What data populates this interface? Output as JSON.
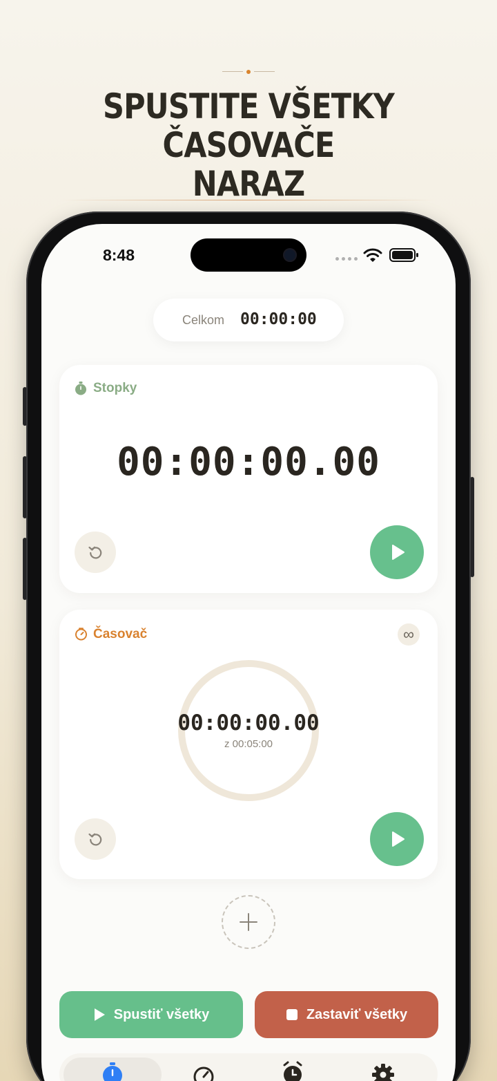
{
  "headline": {
    "line1": "SPUSTITE VŠETKY ČASOVAČE",
    "line2": "NARAZ"
  },
  "status_bar": {
    "time": "8:48"
  },
  "total": {
    "label": "Celkom",
    "value": "00:00:00"
  },
  "stopwatch_card": {
    "title": "Stopky",
    "title_color": "#8aac85",
    "time": "00:00:00.00"
  },
  "timer_card": {
    "title": "Časovač",
    "title_color": "#d9822f",
    "time": "00:00:00.00",
    "subtitle": "z 00:05:00",
    "repeat_icon": "infinity-icon"
  },
  "actions": {
    "start_all": "Spustiť všetky",
    "stop_all": "Zastaviť všetky"
  },
  "colors": {
    "play_green": "#67c08d",
    "stop_red": "#c2614a",
    "active_tab_blue": "#2f7ff5"
  },
  "tabbar": {
    "items": [
      {
        "icon": "stopwatch-icon",
        "active": true
      },
      {
        "icon": "timer-icon",
        "active": false
      },
      {
        "icon": "alarm-icon",
        "active": false
      },
      {
        "icon": "gear-icon",
        "active": false
      }
    ]
  }
}
